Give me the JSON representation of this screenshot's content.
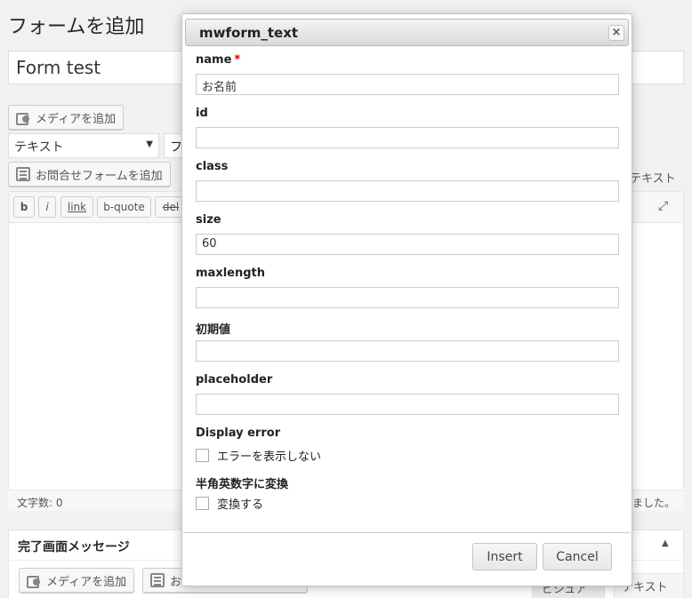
{
  "page": {
    "title": "フォームを追加",
    "form_title_value": "Form test",
    "media_button": "メディアを追加",
    "format_select": "テキスト",
    "format_select2": "フ",
    "contact_form_button": "お問合せフォームを追加",
    "text_tab": "テキスト",
    "quicktags": [
      "b",
      "i",
      "link",
      "b-quote",
      "del"
    ],
    "word_count": "文字数: 0",
    "saved_message": "ました。",
    "complete_box": {
      "title": "完了画面メッセージ",
      "media_button": "メディアを追加",
      "form_button_partial": "お",
      "visual_tab_partial": "ビジュアル",
      "text_tab": "テキスト"
    }
  },
  "modal": {
    "title": "mwform_text",
    "close": "×",
    "fields": {
      "name": {
        "label": "name",
        "required_mark": "*",
        "value": "お名前"
      },
      "id": {
        "label": "id",
        "value": ""
      },
      "class": {
        "label": "class",
        "value": ""
      },
      "size": {
        "label": "size",
        "value": "60"
      },
      "maxlength": {
        "label": "maxlength",
        "value": ""
      },
      "initial": {
        "label": "初期値",
        "value": ""
      },
      "placeholder": {
        "label": "placeholder",
        "value": ""
      }
    },
    "display_error": {
      "label": "Display error",
      "checkbox_label": "エラーを表示しない",
      "checked": false
    },
    "conv_half": {
      "label": "半角英数字に変換",
      "checkbox_label": "変換する",
      "checked": false
    },
    "insert_button": "Insert",
    "cancel_button": "Cancel"
  }
}
